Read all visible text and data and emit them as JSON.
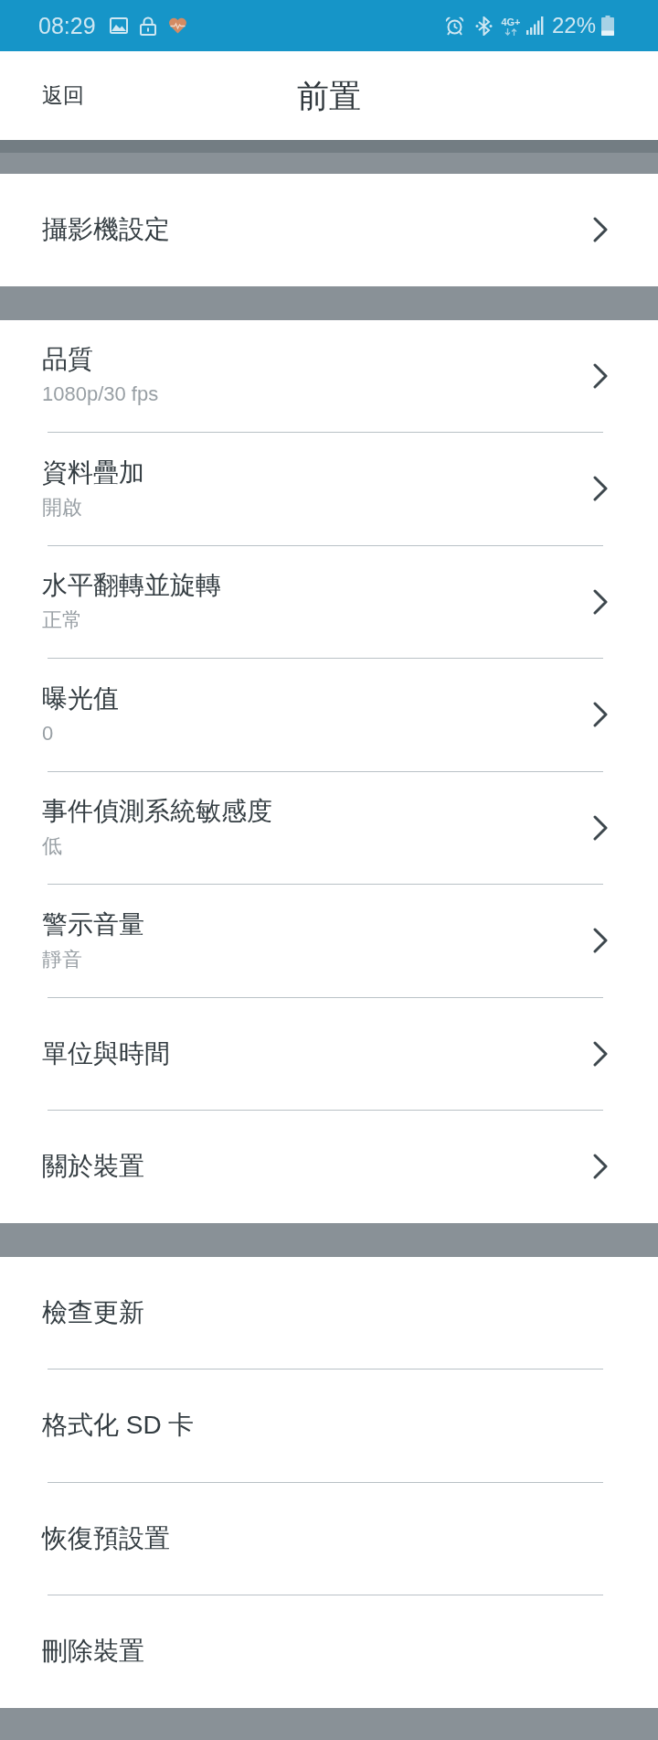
{
  "status_bar": {
    "time": "08:29",
    "network": "4G+",
    "battery": "22%"
  },
  "header": {
    "back": "返回",
    "title": "前置"
  },
  "sections": [
    {
      "items": [
        {
          "title": "攝影機設定",
          "chevron": true
        }
      ]
    },
    {
      "items": [
        {
          "title": "品質",
          "value": "1080p/30 fps",
          "chevron": true
        },
        {
          "title": "資料疊加",
          "value": "開啟",
          "chevron": true
        },
        {
          "title": "水平翻轉並旋轉",
          "value": "正常",
          "chevron": true
        },
        {
          "title": "曝光值",
          "value": "0",
          "chevron": true
        },
        {
          "title": "事件偵測系統敏感度",
          "value": "低",
          "chevron": true
        },
        {
          "title": "警示音量",
          "value": "靜音",
          "chevron": true
        },
        {
          "title": "單位與時間",
          "chevron": true
        },
        {
          "title": "關於裝置",
          "chevron": true
        }
      ]
    },
    {
      "items": [
        {
          "title": "檢查更新",
          "chevron": false
        },
        {
          "title": "格式化 SD 卡",
          "chevron": false
        },
        {
          "title": "恢復預設置",
          "chevron": false
        },
        {
          "title": "刪除裝置",
          "chevron": false
        }
      ]
    }
  ]
}
